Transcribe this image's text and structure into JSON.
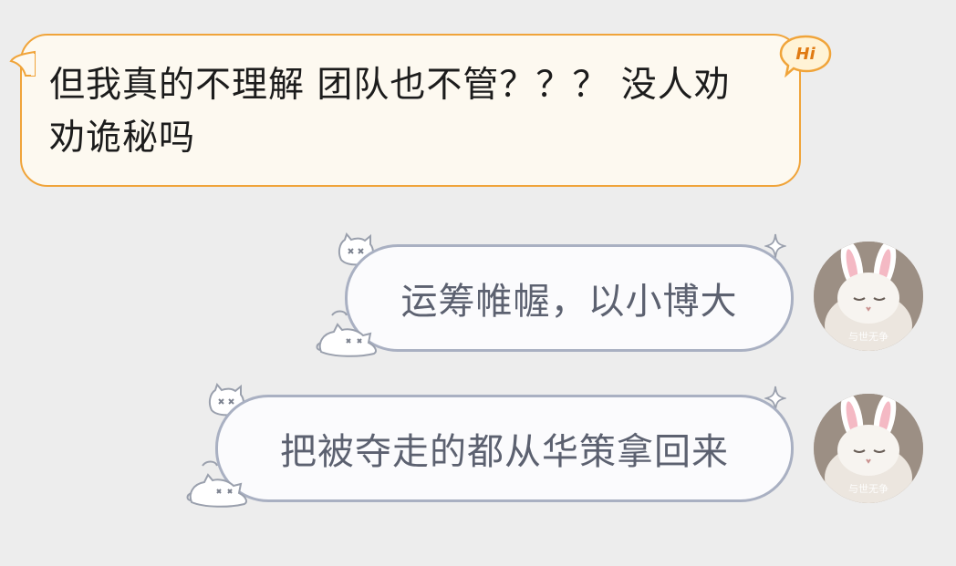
{
  "messages": [
    {
      "id": "msg1",
      "side": "left",
      "text": "但我真的不理解 团队也不管？？？ 没人劝劝诡秘吗",
      "badge": "Hi"
    },
    {
      "id": "msg2",
      "side": "right",
      "text": "运筹帷幄，以小博大"
    },
    {
      "id": "msg3",
      "side": "right",
      "text": "把被夺走的都从华策拿回来"
    }
  ],
  "avatar": {
    "description_icon": "bunny-ear-cat-icon",
    "watermark": "与世无争"
  },
  "colors": {
    "background": "#ededed",
    "incoming_bubble_fill": "#fdf9f0",
    "incoming_bubble_border": "#f0a43a",
    "outgoing_bubble_fill": "#fbfbfd",
    "outgoing_bubble_border": "#a9b0c2",
    "outgoing_text": "#5c6170"
  }
}
